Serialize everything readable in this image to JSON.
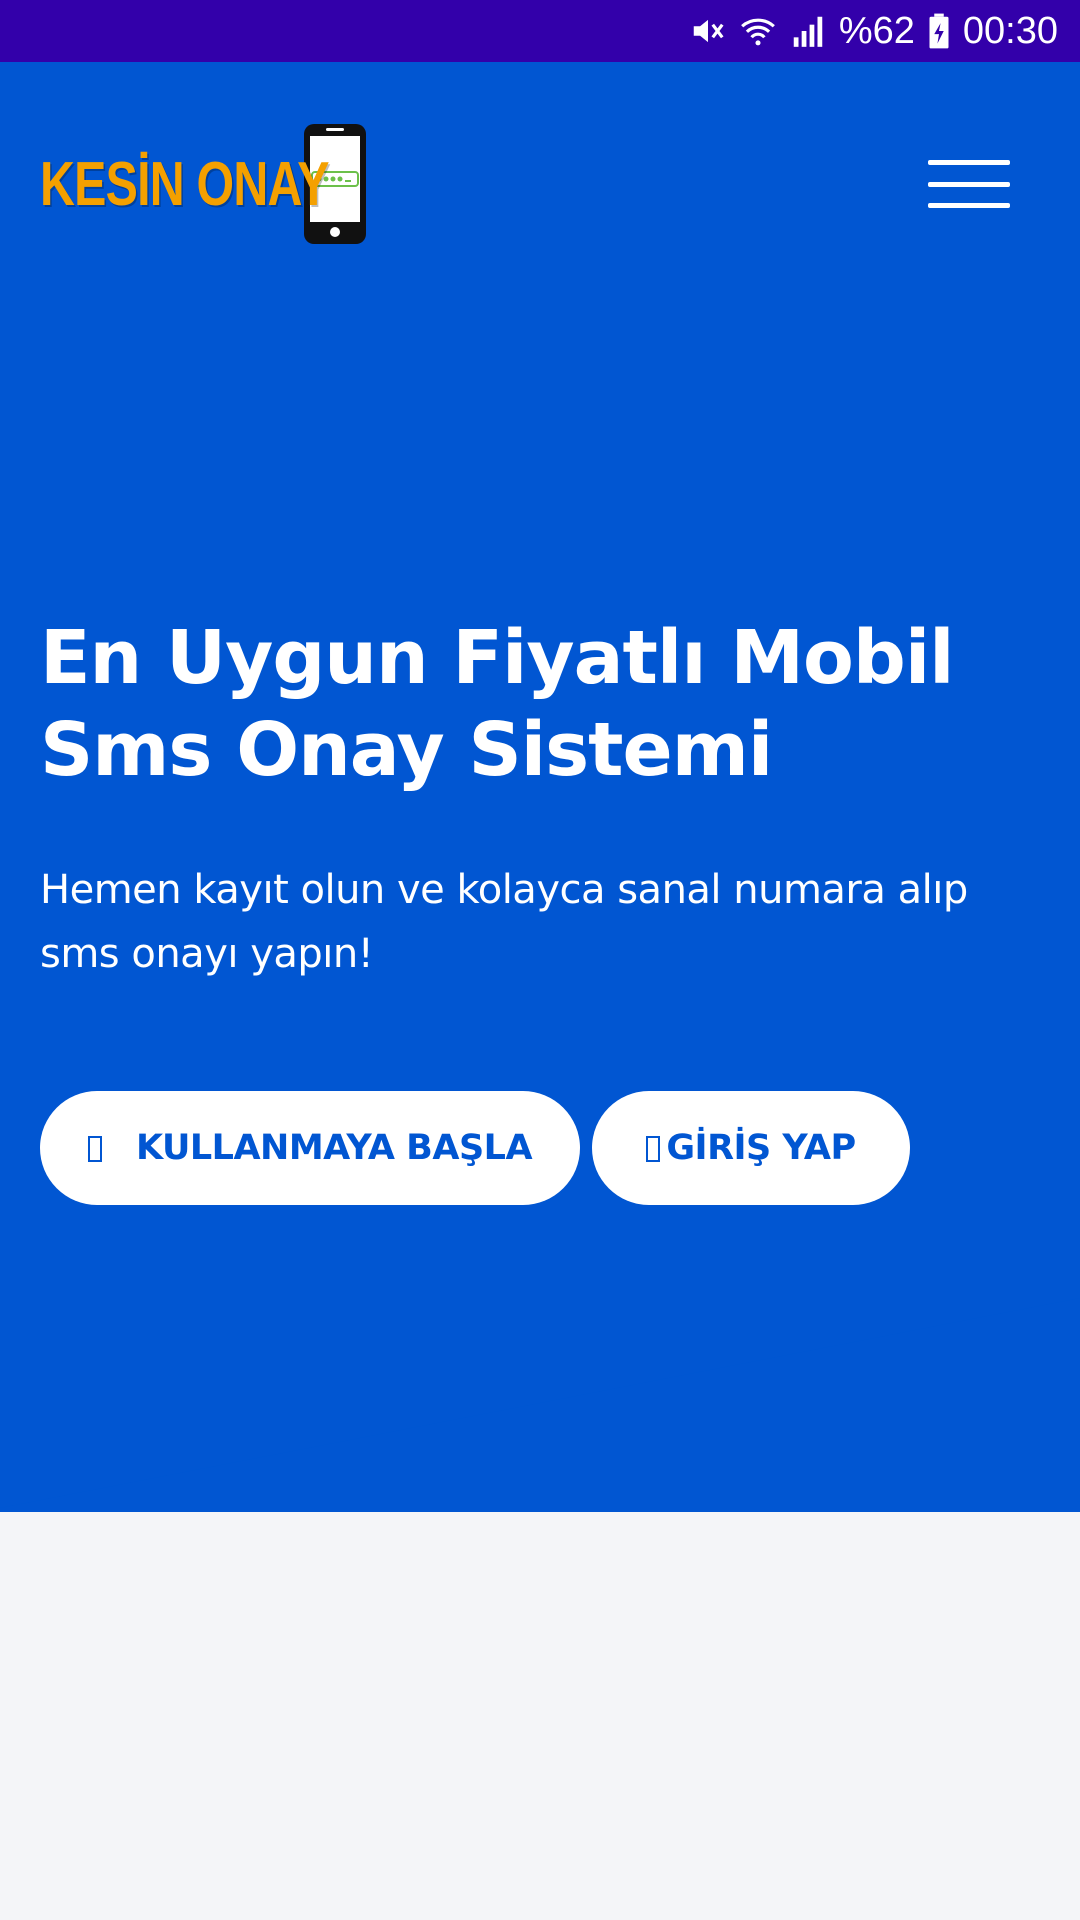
{
  "status_bar": {
    "battery_percent": "%62",
    "time": "00:30",
    "icons": [
      "mute-icon",
      "wifi-icon",
      "signal-icon",
      "battery-charging-icon"
    ]
  },
  "header": {
    "logo_text": "KESİN ONAY",
    "menu_icon": "hamburger-menu-icon"
  },
  "hero": {
    "headline": "En Uygun Fiyatlı Mobil Sms Onay Sistemi",
    "subtext": "Hemen kayıt olun ve kolayca sanal numara alıp sms onayı yapın!",
    "primary_button": "KULLANMAYA BAŞLA",
    "secondary_button": "GİRİŞ YAP"
  },
  "colors": {
    "status_bar": "#3300aa",
    "hero_background": "#0156d2",
    "page_background": "#f4f5f8",
    "logo_text": "#f4a000",
    "button_background": "#ffffff",
    "button_text": "#0156d2"
  }
}
